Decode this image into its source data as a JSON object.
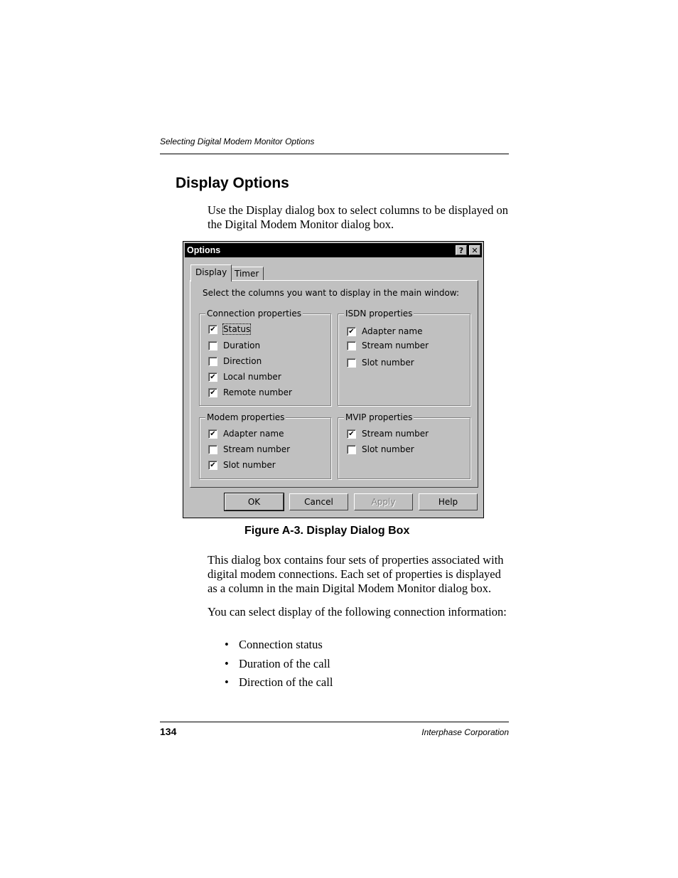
{
  "page": {
    "running_head": "Selecting Digital Modem Monitor Options",
    "heading": "Display Options",
    "intro": "Use the Display dialog box to select columns to be displayed on the Digital Modem Monitor dialog box.",
    "figure_caption": "Figure A-3.  Display Dialog Box",
    "para1": "This dialog box contains four sets of properties associated with digital modem connections. Each set of properties is displayed as a column in the main Digital Modem Monitor dialog box.",
    "para2": "You can select display of the following connection information:",
    "bullets": [
      "Connection status",
      "Duration of the call",
      "Direction of the call"
    ],
    "bullet_glyph": "•",
    "page_number": "134",
    "footer_company": "Interphase Corporation"
  },
  "dialog": {
    "title": "Options",
    "help_icon": "?",
    "close_icon": "✕",
    "tabs": [
      {
        "label": "Display",
        "active": true
      },
      {
        "label": "Timer",
        "active": false
      }
    ],
    "instruction": "Select the columns you want to display in the main window:",
    "check_glyph": "✔",
    "groups": {
      "connection": {
        "label": "Connection properties",
        "items": [
          {
            "label": "Status",
            "checked": true,
            "focused": true
          },
          {
            "label": "Duration",
            "checked": false
          },
          {
            "label": "Direction",
            "checked": false
          },
          {
            "label": "Local number",
            "checked": true
          },
          {
            "label": "Remote number",
            "checked": true
          }
        ]
      },
      "isdn": {
        "label": "ISDN properties",
        "items": [
          {
            "label": "Adapter name",
            "checked": true
          },
          {
            "label": "Stream number",
            "checked": false
          },
          {
            "label": "Slot number",
            "checked": false
          }
        ]
      },
      "modem": {
        "label": "Modem properties",
        "items": [
          {
            "label": "Adapter name",
            "checked": true
          },
          {
            "label": "Stream number",
            "checked": false
          },
          {
            "label": "Slot number",
            "checked": true
          }
        ]
      },
      "mvip": {
        "label": "MVIP properties",
        "items": [
          {
            "label": "Stream number",
            "checked": true
          },
          {
            "label": "Slot number",
            "checked": false
          }
        ]
      }
    },
    "buttons": {
      "ok": "OK",
      "cancel": "Cancel",
      "apply": "Apply",
      "help": "Help"
    }
  }
}
